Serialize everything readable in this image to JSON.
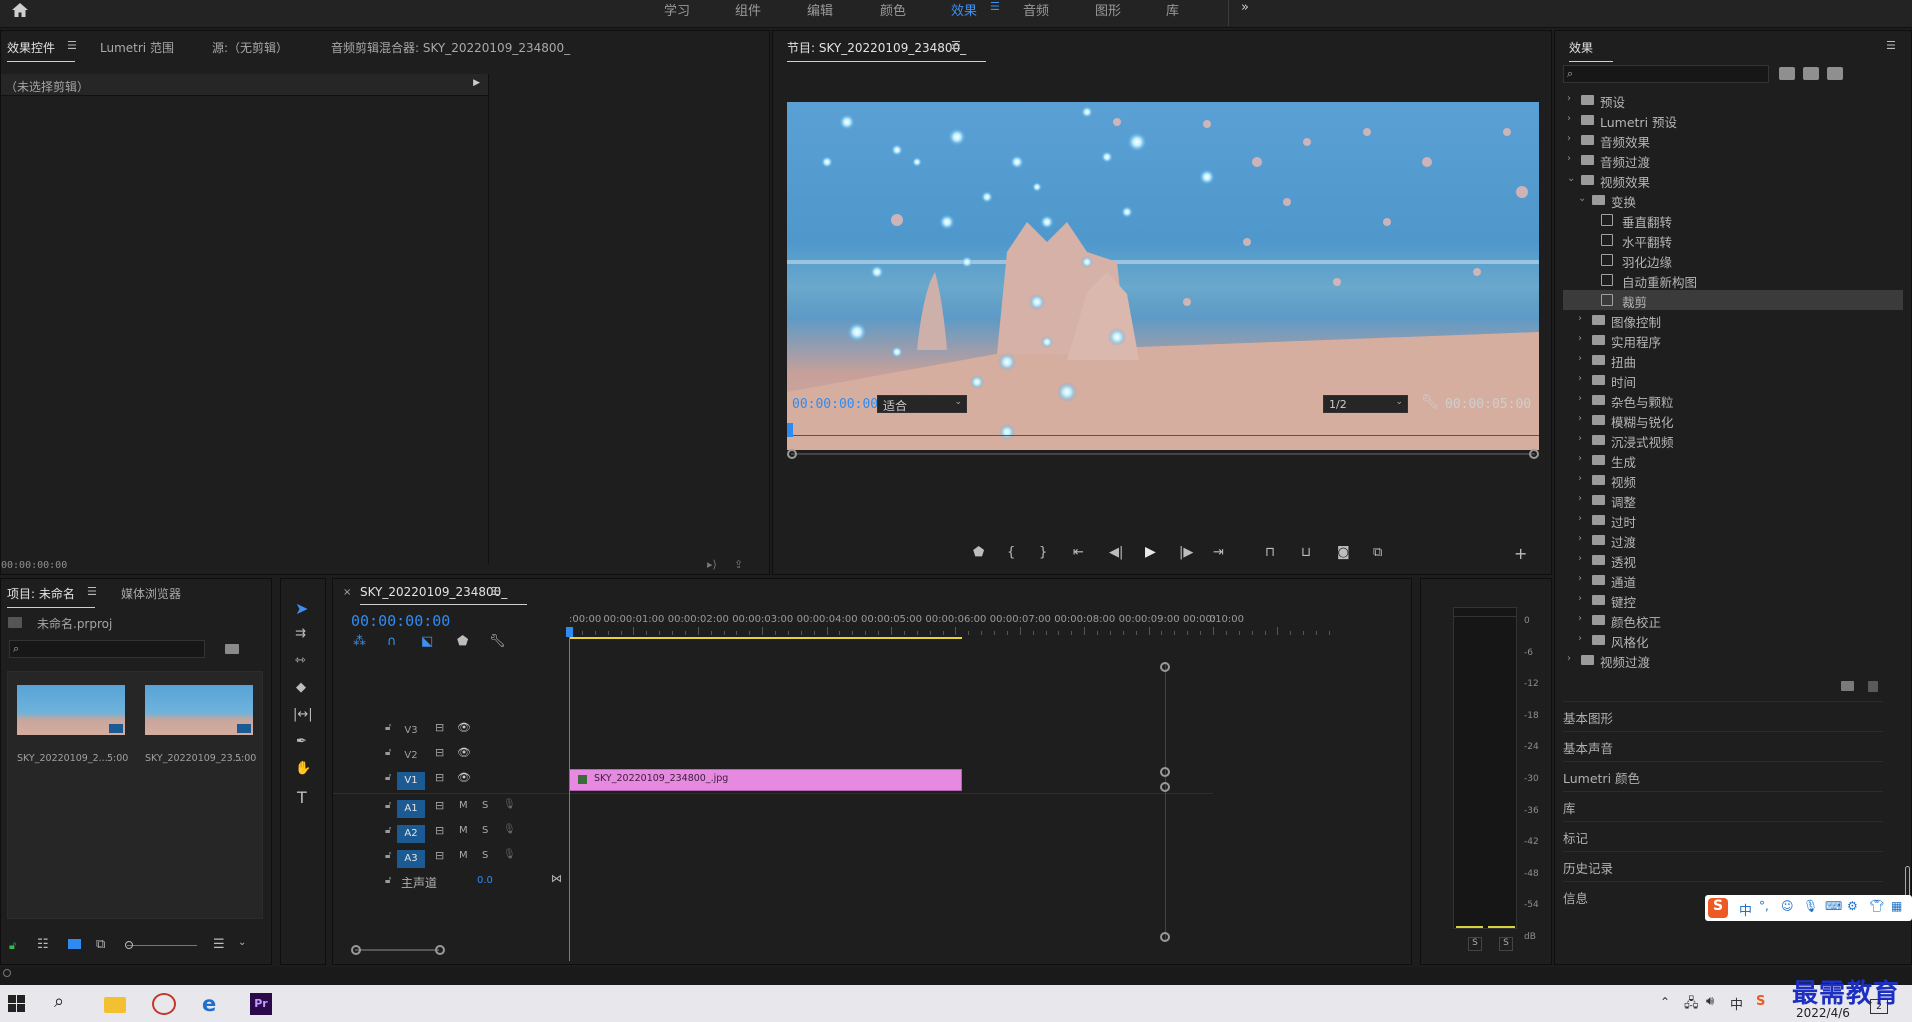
{
  "workspaces": [
    "学习",
    "组件",
    "编辑",
    "颜色",
    "效果",
    "音频",
    "图形",
    "库"
  ],
  "active_workspace": "效果",
  "more_label": "»",
  "effect_controls": {
    "tabs": [
      "效果控件",
      "Lumetri 范围",
      "源:（无剪辑）",
      "音频剪辑混合器: SKY_20220109_234800_"
    ],
    "no_clip": "（未选择剪辑）",
    "timecode": "00:00:00:00"
  },
  "program": {
    "title": "节目: SKY_20220109_234800_",
    "timecode": "00:00:00:00",
    "fit": "适合",
    "resolution": "1/2",
    "duration": "00:00:05:00"
  },
  "effects_panel": {
    "title": "效果",
    "search_placeholder": "",
    "items": [
      {
        "label": "预设",
        "level": 0,
        "kind": "folder",
        "open": false
      },
      {
        "label": "Lumetri 预设",
        "level": 0,
        "kind": "folder",
        "open": false
      },
      {
        "label": "音频效果",
        "level": 0,
        "kind": "folder",
        "open": false
      },
      {
        "label": "音频过渡",
        "level": 0,
        "kind": "folder",
        "open": false
      },
      {
        "label": "视频效果",
        "level": 0,
        "kind": "folder",
        "open": true
      },
      {
        "label": "变换",
        "level": 1,
        "kind": "folder",
        "open": true
      },
      {
        "label": "垂直翻转",
        "level": 2,
        "kind": "effect"
      },
      {
        "label": "水平翻转",
        "level": 2,
        "kind": "effect"
      },
      {
        "label": "羽化边缘",
        "level": 2,
        "kind": "effect"
      },
      {
        "label": "自动重新构图",
        "level": 2,
        "kind": "effect"
      },
      {
        "label": "裁剪",
        "level": 2,
        "kind": "effect",
        "selected": true
      },
      {
        "label": "图像控制",
        "level": 1,
        "kind": "folder",
        "open": false
      },
      {
        "label": "实用程序",
        "level": 1,
        "kind": "folder",
        "open": false
      },
      {
        "label": "扭曲",
        "level": 1,
        "kind": "folder",
        "open": false
      },
      {
        "label": "时间",
        "level": 1,
        "kind": "folder",
        "open": false
      },
      {
        "label": "杂色与颗粒",
        "level": 1,
        "kind": "folder",
        "open": false
      },
      {
        "label": "模糊与锐化",
        "level": 1,
        "kind": "folder",
        "open": false
      },
      {
        "label": "沉浸式视频",
        "level": 1,
        "kind": "folder",
        "open": false
      },
      {
        "label": "生成",
        "level": 1,
        "kind": "folder",
        "open": false
      },
      {
        "label": "视频",
        "level": 1,
        "kind": "folder",
        "open": false
      },
      {
        "label": "调整",
        "level": 1,
        "kind": "folder",
        "open": false
      },
      {
        "label": "过时",
        "level": 1,
        "kind": "folder",
        "open": false
      },
      {
        "label": "过渡",
        "level": 1,
        "kind": "folder",
        "open": false
      },
      {
        "label": "透视",
        "level": 1,
        "kind": "folder",
        "open": false
      },
      {
        "label": "通道",
        "level": 1,
        "kind": "folder",
        "open": false
      },
      {
        "label": "键控",
        "level": 1,
        "kind": "folder",
        "open": false
      },
      {
        "label": "颜色校正",
        "level": 1,
        "kind": "folder",
        "open": false
      },
      {
        "label": "风格化",
        "level": 1,
        "kind": "folder",
        "open": false
      },
      {
        "label": "视频过渡",
        "level": 0,
        "kind": "folder",
        "open": false
      }
    ],
    "subpanels": [
      "基本图形",
      "基本声音",
      "Lumetri 颜色",
      "库",
      "标记",
      "历史记录",
      "信息"
    ]
  },
  "project": {
    "tabs": [
      "项目: 未命名",
      "媒体浏览器"
    ],
    "file": "未命名.prproj",
    "clips": [
      {
        "name": "SKY_20220109_2...",
        "duration": "5:00"
      },
      {
        "name": "SKY_20220109_23...",
        "duration": "5:00"
      }
    ]
  },
  "timeline": {
    "title": "SKY_20220109_234800_",
    "timecode": "00:00:00:00",
    "ruler": [
      ":00:00",
      "00:00:01:00",
      "00:00:02:00",
      "00:00:03:00",
      "00:00:04:00",
      "00:00:05:00",
      "00:00:06:00",
      "00:00:07:00",
      "00:00:08:00",
      "00:00:09:00",
      "00:00:10:00",
      "0"
    ],
    "video_tracks": [
      "V3",
      "V2",
      "V1"
    ],
    "audio_tracks": [
      "A1",
      "A2",
      "A3"
    ],
    "master_label": "主声道",
    "master_value": "0.0",
    "clip_label": "SKY_20220109_234800_.jpg",
    "clip_duration_seconds": 5
  },
  "meter": {
    "scale": [
      "0",
      "-6",
      "-12",
      "-18",
      "-24",
      "-30",
      "-36",
      "-42",
      "-48",
      "-54",
      "dB"
    ],
    "solo": [
      "S",
      "S"
    ]
  },
  "ime": {
    "label": "中"
  },
  "watermark": "最需教育",
  "taskbar": {
    "date": "2022/4/6",
    "notif": "2"
  }
}
